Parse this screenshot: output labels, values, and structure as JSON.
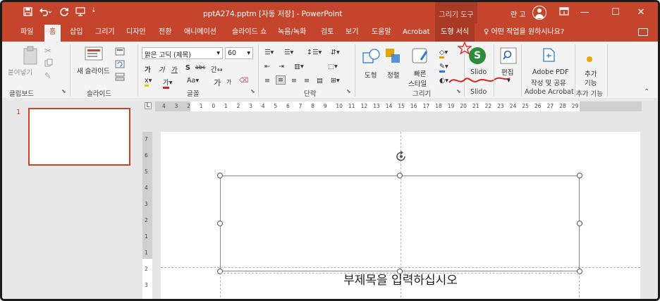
{
  "titlebar": {
    "window_title": "pptA274.pptm [자동 저장] - PowerPoint",
    "context_tab": "그리기 도구",
    "user": "란 고",
    "minimize": "—",
    "maximize": "☐",
    "close": "✕"
  },
  "tabs": [
    "파일",
    "홈",
    "삽입",
    "그리기",
    "디자인",
    "전환",
    "애니메이션",
    "슬라이드 쇼",
    "녹음/녹화",
    "검토",
    "보기",
    "도움말",
    "Acrobat",
    "도형 서식"
  ],
  "active_tab": "홈",
  "tell_me": "어떤 작업을 원하시나요?",
  "ribbon": {
    "clipboard": {
      "paste": "붙여넣기",
      "label": "클립보드"
    },
    "slides": {
      "new_slide": "새 슬라이드",
      "label": "슬라이드"
    },
    "font": {
      "font_name": "맑은 고딕 (제목)",
      "font_size": "60",
      "label": "글꼴",
      "bold": "가",
      "italic": "가",
      "underline": "가",
      "strike": "가",
      "aa": "Aa",
      "grow": "가",
      "shrink": "가"
    },
    "paragraph": {
      "label": "단락"
    },
    "drawing": {
      "shape": "도형",
      "arrange": "정렬",
      "quick_styles_1": "빠른",
      "quick_styles_2": "스타일",
      "label": "그리기"
    },
    "slido": {
      "label_btn": "Slido",
      "label": "Slido"
    },
    "editing": {
      "edit": "편집"
    },
    "acrobat": {
      "create_1": "Adobe PDF",
      "create_2": "작성 및 공유",
      "label": "Adobe Acrobat"
    },
    "addins": {
      "add_1": "추가",
      "add_2": "기능",
      "label": "추가 기능"
    }
  },
  "thumbnail": {
    "number": "1"
  },
  "ruler": {
    "h_ticks": [
      "4",
      "3",
      "2",
      "1",
      "0",
      "1",
      "2",
      "3",
      "4",
      "5",
      "6",
      "7",
      "8",
      "9",
      "10",
      "11",
      "12",
      "13",
      "14",
      "15",
      "16",
      "17",
      "18",
      "19",
      "20",
      "21",
      "22",
      "23",
      "24",
      "25",
      "26",
      "27",
      "28",
      "29"
    ],
    "v_ticks": [
      "7",
      "6",
      "5",
      "4",
      "3",
      "2",
      "1",
      "1",
      "2",
      "3"
    ]
  },
  "slide": {
    "subtitle_placeholder": "부제목을 입력하십시오"
  },
  "colors": {
    "accent": "#c4452c",
    "context_dark": "#a83a26",
    "slido_green": "#2e8b3a",
    "ribbon_bg": "#f3f3f3"
  }
}
